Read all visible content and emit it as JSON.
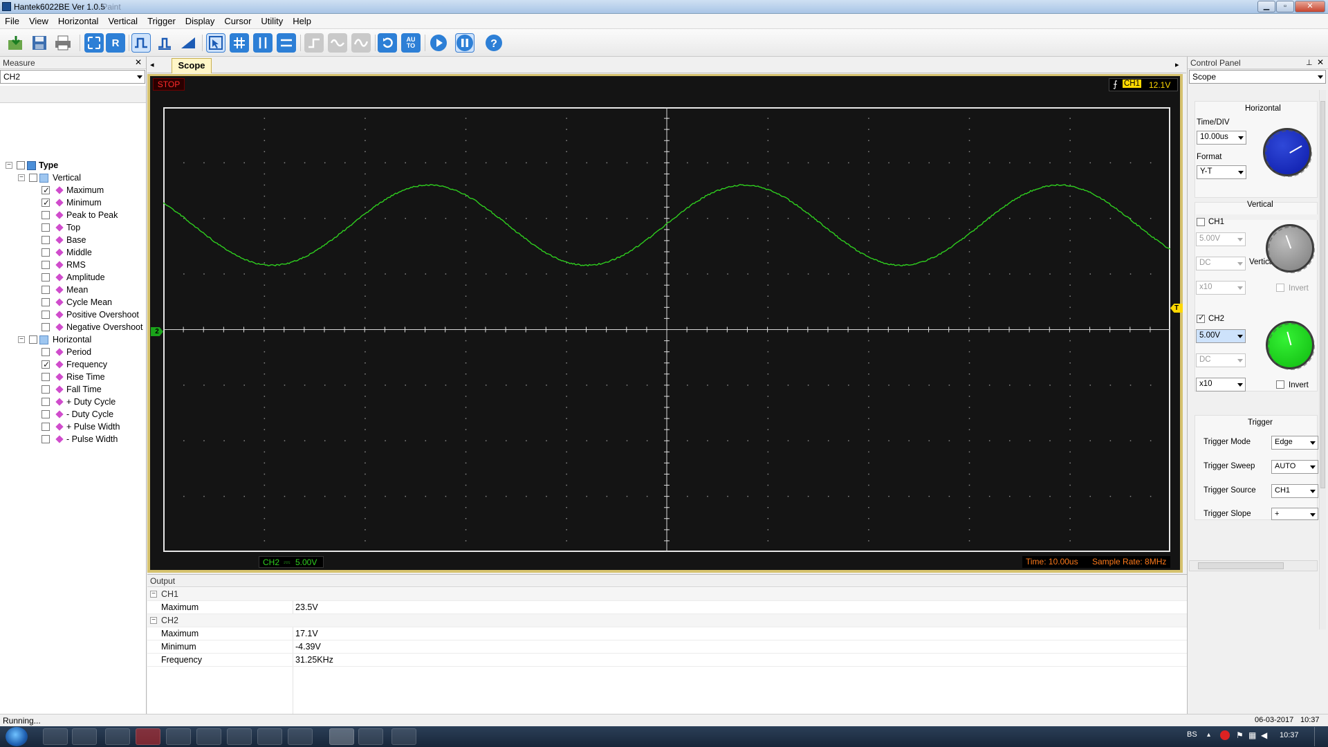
{
  "window": {
    "title": "Hantek6022BE Ver 1.0.5",
    "title_suffix": "- Paint",
    "min": "0",
    "max": "1",
    "close": "r"
  },
  "menu": [
    "File",
    "View",
    "Horizontal",
    "Vertical",
    "Trigger",
    "Display",
    "Cursor",
    "Utility",
    "Help"
  ],
  "toolbar_icons": [
    "open-icon",
    "save-icon",
    "print-icon",
    "auto-measure-icon",
    "reset-icon",
    "ch1-icon",
    "ch2-icon",
    "math-icon",
    "cursor-icon",
    "grid-icon",
    "vcursor-icon",
    "hcursor-icon",
    "step-icon",
    "sine-icon",
    "wave-icon",
    "loop-icon",
    "auto-icon",
    "run-icon",
    "pause-icon",
    "help-icon"
  ],
  "measure": {
    "title": "Measure",
    "close": "✕",
    "channel": "CH2",
    "tree": {
      "root": "Type",
      "vertical": {
        "label": "Vertical",
        "items": [
          {
            "label": "Maximum",
            "checked": true
          },
          {
            "label": "Minimum",
            "checked": true
          },
          {
            "label": "Peak to Peak",
            "checked": false
          },
          {
            "label": "Top",
            "checked": false
          },
          {
            "label": "Base",
            "checked": false
          },
          {
            "label": "Middle",
            "checked": false
          },
          {
            "label": "RMS",
            "checked": false
          },
          {
            "label": "Amplitude",
            "checked": false
          },
          {
            "label": "Mean",
            "checked": false
          },
          {
            "label": "Cycle Mean",
            "checked": false
          },
          {
            "label": "Positive Overshoot",
            "checked": false
          },
          {
            "label": "Negative Overshoot",
            "checked": false
          }
        ]
      },
      "horizontal": {
        "label": "Horizontal",
        "items": [
          {
            "label": "Period",
            "checked": false
          },
          {
            "label": "Frequency",
            "checked": true
          },
          {
            "label": "Rise Time",
            "checked": false
          },
          {
            "label": "Fall Time",
            "checked": false
          },
          {
            "label": "+ Duty Cycle",
            "checked": false
          },
          {
            "label": "- Duty Cycle",
            "checked": false
          },
          {
            "label": "+ Pulse Width",
            "checked": false
          },
          {
            "label": "- Pulse Width",
            "checked": false
          }
        ]
      }
    }
  },
  "scope": {
    "tab": "Scope",
    "state": "STOP",
    "trigger_channel": "CH1",
    "trigger_level": "12.1V",
    "ch_label": "CH2",
    "ch_scale": "5.00V",
    "marker_channel": "2",
    "marker_trigger": "T",
    "time": "Time: 10.00us",
    "sample_rate": "Sample Rate: 8MHz",
    "colors": {
      "trace": "#2fcf1f",
      "state": "#ff2a2a",
      "accent": "#ffd800"
    }
  },
  "output": {
    "title": "Output",
    "close": "✕",
    "groups": [
      {
        "name": "CH1",
        "rows": [
          {
            "k": "Maximum",
            "v": "23.5V"
          }
        ]
      },
      {
        "name": "CH2",
        "rows": [
          {
            "k": "Maximum",
            "v": "17.1V"
          },
          {
            "k": "Minimum",
            "v": "-4.39V"
          },
          {
            "k": "Frequency",
            "v": "31.25KHz"
          }
        ]
      }
    ]
  },
  "control": {
    "title": "Control Panel",
    "pin": "⊥",
    "close": "✕",
    "view": "Scope",
    "horizontal": {
      "title": "Horizontal",
      "timediv_label": "Time/DIV",
      "timediv": "10.00us",
      "format_label": "Format",
      "format": "Y-T"
    },
    "vertical": {
      "title": "Vertical",
      "ch1": {
        "label": "CH1",
        "enabled": false,
        "volt": "5.00V",
        "coupling": "DC",
        "probe": "x10",
        "invert": "Invert"
      },
      "ch2": {
        "label": "CH2",
        "enabled": true,
        "volt": "5.00V",
        "coupling": "DC",
        "probe": "x10",
        "invert": "Invert"
      }
    },
    "trigger": {
      "title": "Trigger",
      "mode_label": "Trigger Mode",
      "mode": "Edge",
      "sweep_label": "Trigger Sweep",
      "sweep": "AUTO",
      "source_label": "Trigger Source",
      "source": "CH1",
      "slope_label": "Trigger Slope",
      "slope": "+"
    }
  },
  "status": {
    "text": "Running...",
    "date": "06-03-2017",
    "time": "10:37"
  },
  "taskbar": {
    "lang": "BS",
    "clock": "10:37",
    "date": "06-03-2017"
  }
}
